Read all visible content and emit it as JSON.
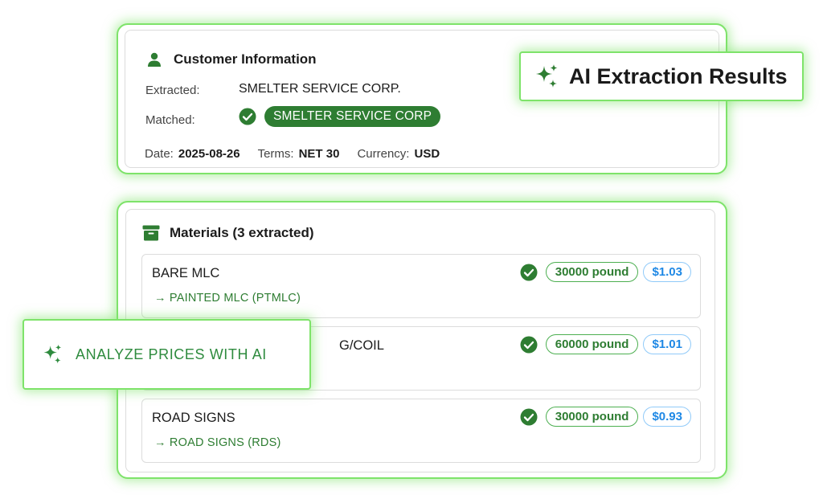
{
  "customer": {
    "title": "Customer Information",
    "extracted_label": "Extracted:",
    "extracted_value": "SMELTER SERVICE CORP.",
    "matched_label": "Matched:",
    "matched_value": "SMELTER SERVICE CORP",
    "date_label": "Date:",
    "date_value": "2025-08-26",
    "terms_label": "Terms:",
    "terms_value": "NET 30",
    "currency_label": "Currency:",
    "currency_value": "USD"
  },
  "ai_results": {
    "label": "AI Extraction Results"
  },
  "materials": {
    "title": "Materials (3 extracted)",
    "items": [
      {
        "name": "BARE MLC",
        "mapped": "→ PAINTED MLC (PTMLC)",
        "quantity": "30000 pound",
        "price": "$1.03"
      },
      {
        "name": "G/COIL",
        "mapped": "",
        "quantity": "60000 pound",
        "price": "$1.01"
      },
      {
        "name": "ROAD SIGNS",
        "mapped": "→ ROAD SIGNS (RDS)",
        "quantity": "30000 pound",
        "price": "$0.93"
      }
    ]
  },
  "analyze": {
    "label": "ANALYZE PRICES WITH AI"
  },
  "colors": {
    "glow": "#7ee36a",
    "match_green": "#2e7d32",
    "price_blue": "#1e88e5"
  }
}
